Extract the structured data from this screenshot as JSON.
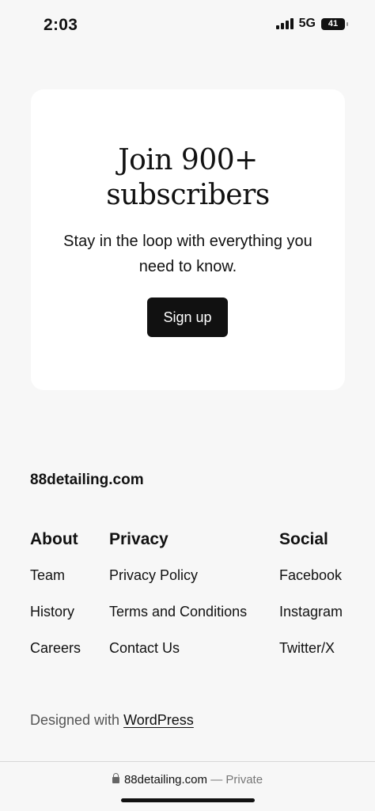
{
  "status_bar": {
    "time": "2:03",
    "network": "5G",
    "battery_level": "41",
    "battery_fraction": 0.41
  },
  "newsletter": {
    "title": "Join 900+ subscribers",
    "text": "Stay in the loop with everything you need to know.",
    "button_label": "Sign up"
  },
  "footer": {
    "site_name": "88detailing.com",
    "columns": [
      {
        "heading": "About",
        "links": [
          "Team",
          "History",
          "Careers"
        ]
      },
      {
        "heading": "Privacy",
        "links": [
          "Privacy Policy",
          "Terms and Conditions",
          "Contact Us"
        ]
      },
      {
        "heading": "Social",
        "links": [
          "Facebook",
          "Instagram",
          "Twitter/X"
        ]
      }
    ],
    "credit_prefix": "Designed with ",
    "credit_link": "WordPress"
  },
  "browser": {
    "domain": "88detailing.com",
    "privacy": "— Private",
    "lock_icon": "lock-icon"
  },
  "colors": {
    "background": "#f7f7f7",
    "card": "#ffffff",
    "button": "#111111"
  }
}
